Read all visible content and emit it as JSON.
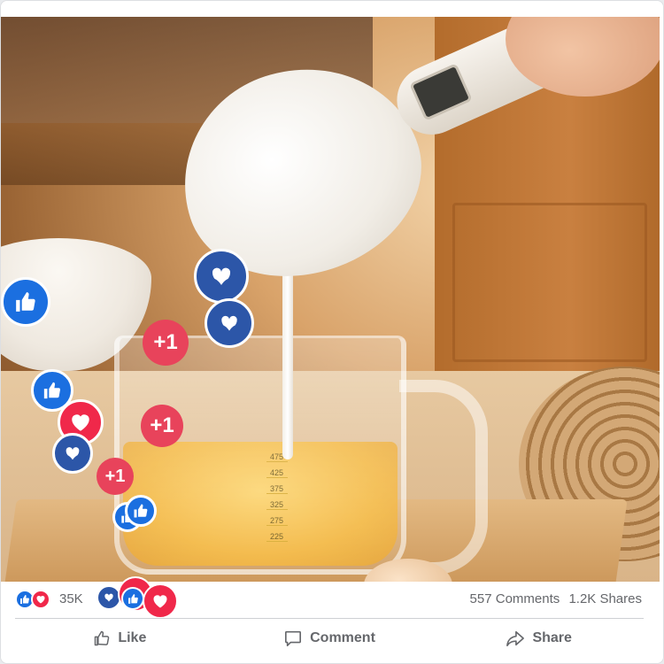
{
  "post": {
    "photo": {
      "icon": "kitchen-photo",
      "measure_marks": [
        "475",
        "425",
        "375",
        "325",
        "275",
        "225"
      ]
    },
    "floating_reactions": {
      "plus_label": "+1",
      "icons": [
        "like-icon",
        "love-icon",
        "care-icon"
      ],
      "colors": {
        "like": "#1b6fe0",
        "love": "#f0284a",
        "care": "#2c56a8",
        "plus": "#e8435b"
      }
    },
    "reactions_summary": {
      "icons": [
        "like-icon",
        "love-icon"
      ],
      "count": "35K"
    },
    "stats": {
      "comments": "557 Comments",
      "shares": "1.2K Shares"
    },
    "actions": {
      "like": {
        "label": "Like",
        "icon": "thumbs-up-icon"
      },
      "comment": {
        "label": "Comment",
        "icon": "comment-icon"
      },
      "share": {
        "label": "Share",
        "icon": "share-arrow-icon"
      }
    }
  }
}
